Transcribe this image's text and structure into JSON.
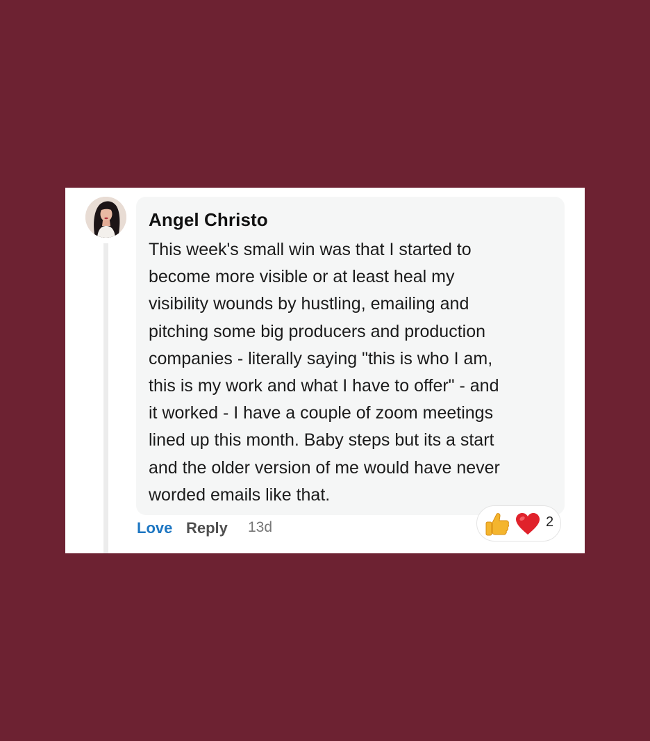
{
  "comment": {
    "author": "Angel Christo",
    "text_lines": [
      "This week's small win was that I started to",
      "become more visible or at least heal my",
      "visibility wounds by hustling, emailing and",
      "pitching some big producers and production",
      "companies - literally saying \"this is who I am,",
      "this is my work and what I have to offer\" - and",
      "it worked - I have a couple of zoom meetings",
      "lined up this month. Baby steps but its a start",
      "and the older version of me would have never",
      "worded emails like that."
    ],
    "actions": {
      "love_label": "Love",
      "reply_label": "Reply",
      "timestamp": "13d"
    },
    "reactions": {
      "icons": [
        "thumbs-up-icon",
        "heart-icon"
      ],
      "count": "2"
    }
  },
  "colors": {
    "page_background": "#6d2232",
    "card_background": "#ffffff",
    "bubble_background": "#f5f6f6",
    "love_link": "#1d76c2",
    "heart": "#e0222b",
    "thumb": "#f4b52e"
  }
}
